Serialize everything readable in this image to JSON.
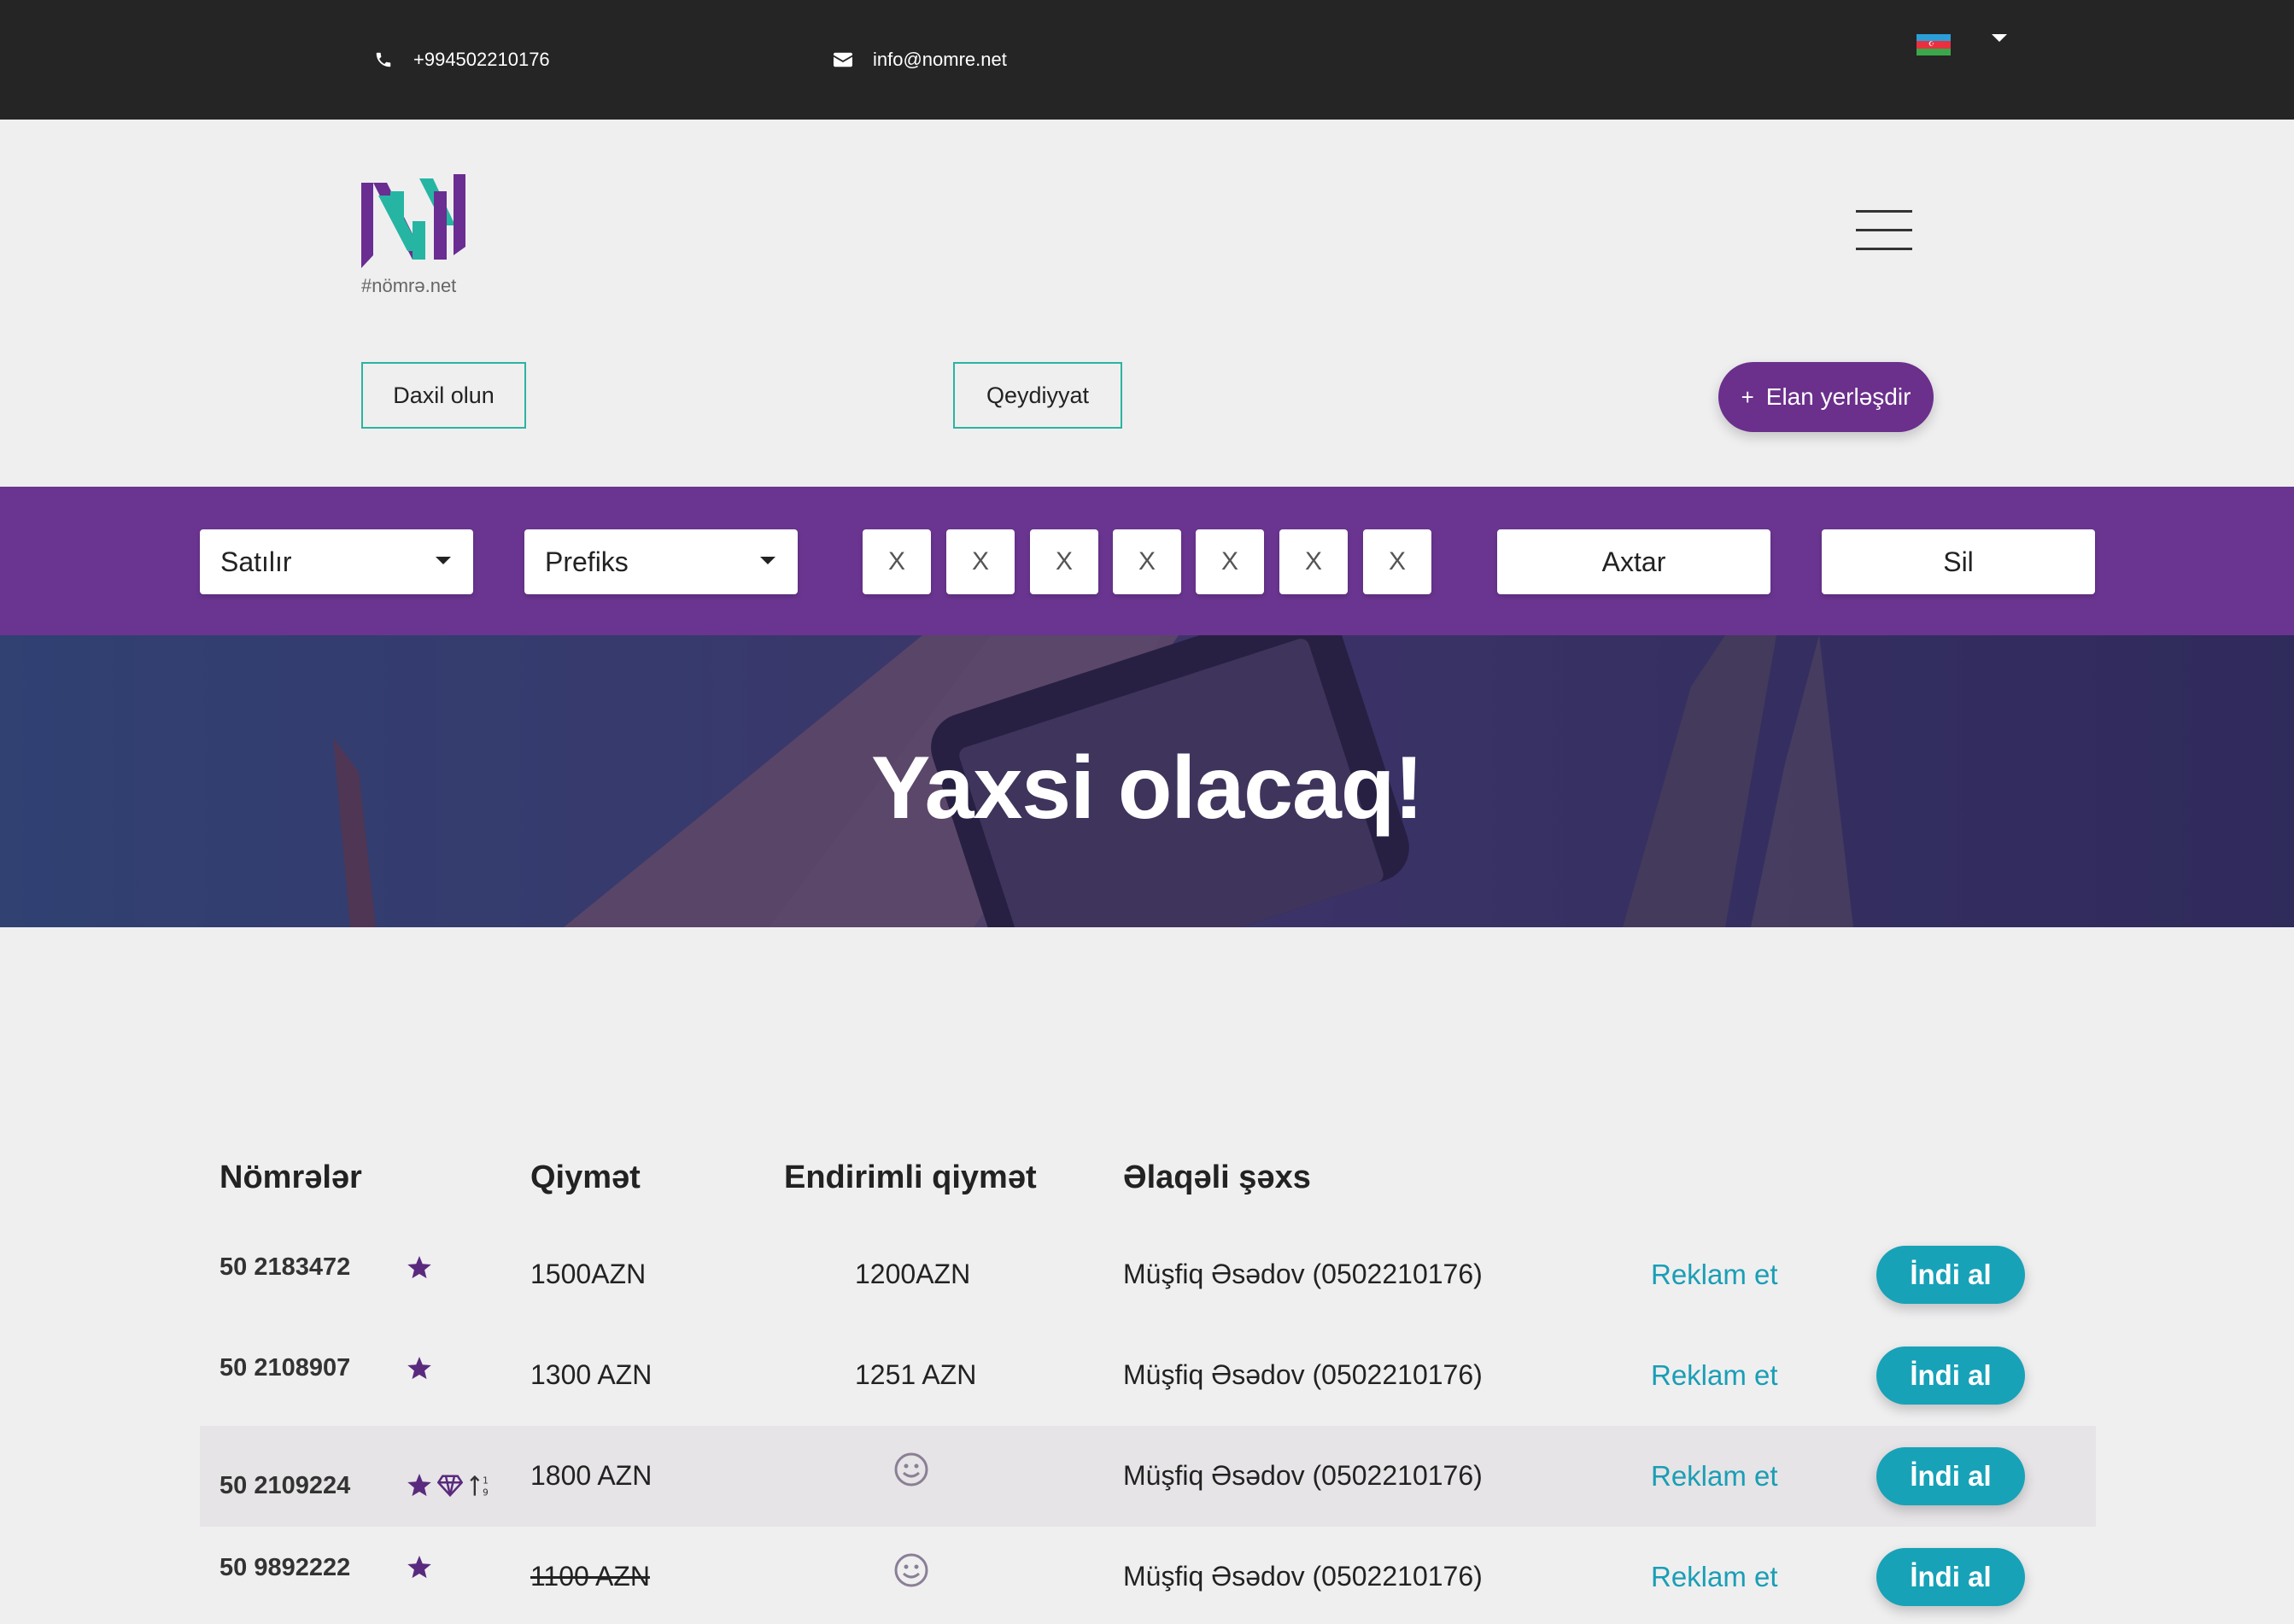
{
  "topbar": {
    "phone": "+994502210176",
    "email": "info@nomre.net",
    "language_flag": "azerbaijan-flag",
    "colors": {
      "background": "#252525"
    }
  },
  "header": {
    "logo_text": "#nömrə.net",
    "login_label": "Daxil olun",
    "register_label": "Qeydiyyat",
    "post_ad_label": "Elan yerləşdir",
    "post_ad_plus": "+",
    "colors": {
      "accent": "#6b2f8c",
      "outline": "#2ab4a0"
    }
  },
  "search": {
    "type_select": "Satılır",
    "prefix_select": "Prefiks",
    "digits": [
      "X",
      "X",
      "X",
      "X",
      "X",
      "X",
      "X"
    ],
    "search_label": "Axtar",
    "clear_label": "Sil",
    "colors": {
      "background": "#6a3590"
    }
  },
  "hero": {
    "title": "Yaxsi olacaq!"
  },
  "table": {
    "headers": {
      "numbers": "Nömrələr",
      "price": "Qiymət",
      "discount": "Endirimli qiymət",
      "contact": "Əlaqəli şəxs"
    },
    "rows": [
      {
        "number": "50 2183472",
        "badges": [
          "star-icon"
        ],
        "price": "1500AZN",
        "price_struck": false,
        "discount": "1200AZN",
        "discount_icon": "",
        "contact": "Müşfiq Əsədov (0502210176)",
        "advertise": "Reklam et",
        "buy": "İndi al"
      },
      {
        "number": "50 2108907",
        "badges": [
          "star-icon"
        ],
        "price": "1300 AZN",
        "price_struck": false,
        "discount": "1251 AZN",
        "discount_icon": "",
        "contact": "Müşfiq Əsədov (0502210176)",
        "advertise": "Reklam et",
        "buy": "İndi al"
      },
      {
        "number": "50 2109224",
        "badges": [
          "star-icon",
          "diamond-icon",
          "sort-numeric-icon"
        ],
        "price": "1800 AZN",
        "price_struck": false,
        "discount": "",
        "discount_icon": "smiley-icon",
        "contact": "Müşfiq Əsədov (0502210176)",
        "advertise": "Reklam et",
        "buy": "İndi al"
      },
      {
        "number": "50 9892222",
        "badges": [
          "star-icon"
        ],
        "price": "1100 AZN",
        "price_struck": true,
        "discount": "",
        "discount_icon": "smiley-icon",
        "contact": "Müşfiq Əsədov (0502210176)",
        "advertise": "Reklam et",
        "buy": "İndi al"
      }
    ],
    "colors": {
      "link": "#1a9eb5",
      "buy_button": "#17a2b8",
      "star": "#5a2a7e"
    }
  }
}
